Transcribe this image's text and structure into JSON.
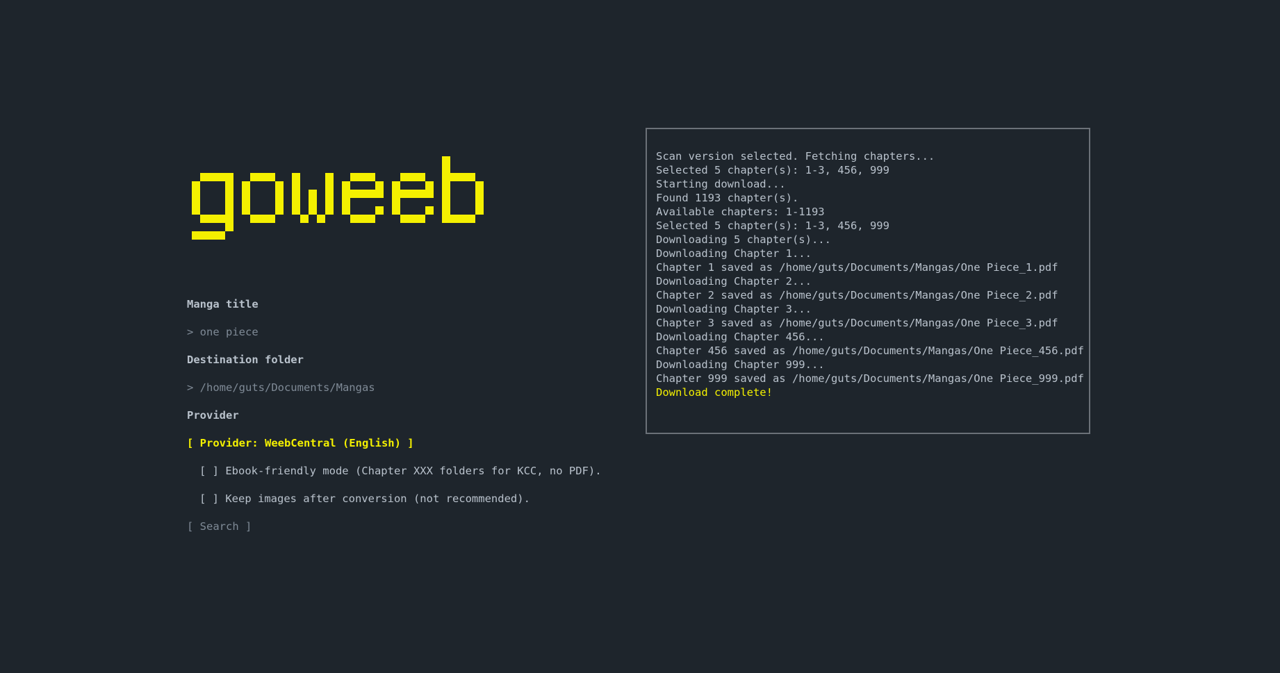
{
  "app": {
    "name": "goweeb",
    "accent_color": "#f4f000",
    "background_color": "#1e252c"
  },
  "form": {
    "manga_title_label": "Manga title",
    "manga_title_value": "> one piece",
    "destination_label": "Destination folder",
    "destination_value": "> /home/guts/Documents/Mangas",
    "provider_label": "Provider",
    "provider_selected": "[ Provider: WeebCentral (English) ]",
    "ebook_option": "[ ] Ebook-friendly mode (Chapter XXX folders for KCC, no PDF).",
    "keep_images_option": "[ ] Keep images after conversion (not recommended).",
    "search_button": "[ Search ]"
  },
  "log": {
    "lines": [
      "Scan version selected. Fetching chapters...",
      "Selected 5 chapter(s): 1-3, 456, 999",
      "Starting download...",
      "Found 1193 chapter(s).",
      "Available chapters: 1-1193",
      "Selected 5 chapter(s): 1-3, 456, 999",
      "Downloading 5 chapter(s)...",
      "Downloading Chapter 1...",
      "Chapter 1 saved as /home/guts/Documents/Mangas/One Piece_1.pdf",
      "Downloading Chapter 2...",
      "Chapter 2 saved as /home/guts/Documents/Mangas/One Piece_2.pdf",
      "Downloading Chapter 3...",
      "Chapter 3 saved as /home/guts/Documents/Mangas/One Piece_3.pdf",
      "Downloading Chapter 456...",
      "Chapter 456 saved as /home/guts/Documents/Mangas/One Piece_456.pdf",
      "Downloading Chapter 999...",
      "Chapter 999 saved as /home/guts/Documents/Mangas/One Piece_999.pdf"
    ],
    "complete_message": "Download complete!"
  }
}
